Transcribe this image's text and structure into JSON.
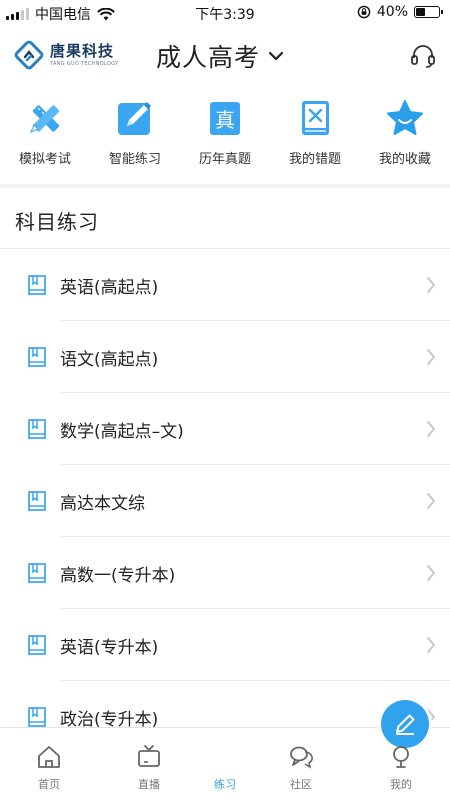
{
  "status_bar": {
    "carrier": "中国电信",
    "time": "下午3:39",
    "battery_text": "40%",
    "battery_level": 0.4
  },
  "header": {
    "logo_cn": "唐果科技",
    "logo_en": "TANG GUO TECHNOLOGY",
    "title": "成人高考",
    "headset_icon": "headset-icon"
  },
  "quick_actions": [
    {
      "label": "模拟考试",
      "icon": "pencil-ruler-icon"
    },
    {
      "label": "智能练习",
      "icon": "edit-icon"
    },
    {
      "label": "历年真题",
      "icon": "real-exam-icon"
    },
    {
      "label": "我的错题",
      "icon": "wrong-book-icon"
    },
    {
      "label": "我的收藏",
      "icon": "star-icon"
    }
  ],
  "section_title": "科目练习",
  "subjects": [
    {
      "name": "英语(高起点)"
    },
    {
      "name": "语文(高起点)"
    },
    {
      "name": "数学(高起点–文)"
    },
    {
      "name": "高达本文综"
    },
    {
      "name": "高数一(专升本)"
    },
    {
      "name": "英语(专升本)"
    },
    {
      "name": "政治(专升本)"
    }
  ],
  "tabs": [
    {
      "label": "首页",
      "icon": "home-icon",
      "active": false
    },
    {
      "label": "直播",
      "icon": "tv-icon",
      "active": false
    },
    {
      "label": "练习",
      "icon": "pen-icon",
      "active": true
    },
    {
      "label": "社区",
      "icon": "chat-icon",
      "active": false
    },
    {
      "label": "我的",
      "icon": "profile-icon",
      "active": false
    }
  ],
  "colors": {
    "accent": "#2f9fe8",
    "icon_blue": "#3aa6ef",
    "star_blue": "#2b9ee8",
    "title_text": "#222222",
    "muted": "#777777"
  }
}
